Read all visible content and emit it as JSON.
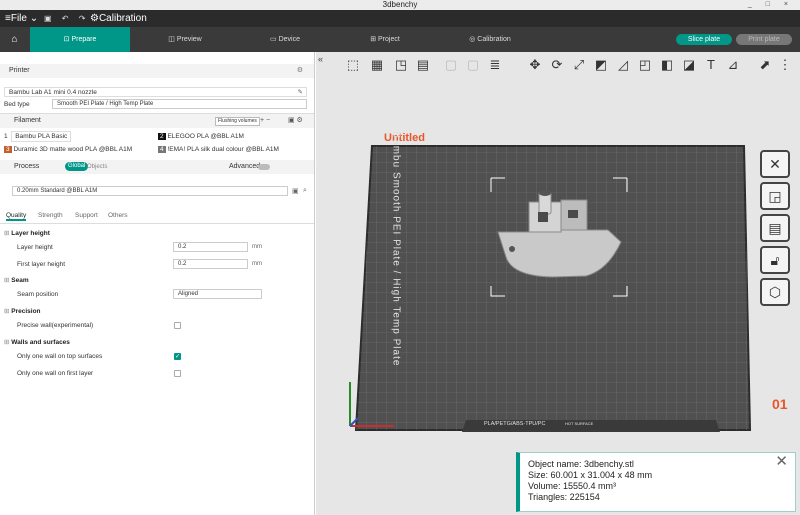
{
  "window": {
    "title": "3dbenchy",
    "controls": "_ □ ×"
  },
  "menubar": {
    "file": "≡File ⌄",
    "project_name": "⚙Calibration",
    "icons": "▣ ↶ ↷"
  },
  "tabs": [
    {
      "label": "Prepare",
      "icon": "⊡"
    },
    {
      "label": "Preview",
      "icon": "◫"
    },
    {
      "label": "Device",
      "icon": "▭"
    },
    {
      "label": "Project",
      "icon": "⊞"
    },
    {
      "label": "Calibration",
      "icon": "◎"
    }
  ],
  "actions": {
    "slice": "Slice plate",
    "print": "Print plate"
  },
  "printer": {
    "section": "Printer",
    "model": "Bambu Lab A1 mini 0.4 nozzle",
    "bed_type_label": "Bed type",
    "bed_type": "Smooth PEI Plate / High Temp Plate"
  },
  "filament": {
    "section": "Filament",
    "flushing": "Flushing volumes",
    "slots": [
      {
        "num": "1",
        "name": "Bambu PLA Basic",
        "color": "#f0f0f0"
      },
      {
        "num": "2",
        "name": "ELEGOO PLA @BBL A1M",
        "color": "#111111"
      },
      {
        "num": "3",
        "name": "Duramic 3D matte wood PLA @BBL A1M",
        "color": "#c06030"
      },
      {
        "num": "4",
        "name": "!EMA! PLA silk dual colour @BBL A1M",
        "color": "#777777"
      }
    ]
  },
  "process": {
    "section": "Process",
    "global": "Global",
    "objects": "Objects",
    "advanced": "Advanced",
    "preset": "0.20mm Standard @BBL A1M",
    "tabs": [
      "Quality",
      "Strength",
      "Support",
      "Others"
    ]
  },
  "settings": {
    "layer_height_group": "Layer height",
    "layer_height_label": "Layer height",
    "layer_height_value": "0.2",
    "first_layer_label": "First layer height",
    "first_layer_value": "0.2",
    "unit": "mm",
    "seam_group": "Seam",
    "seam_label": "Seam position",
    "seam_value": "Aligned",
    "precision_group": "Precision",
    "precise_wall_label": "Precise wall(experimental)",
    "walls_group": "Walls and surfaces",
    "top_wall_label": "Only one wall on top surfaces",
    "first_wall_label": "Only one wall on first layer"
  },
  "viewport": {
    "plate_name": "Untitled",
    "plate_text": "Bambu Smooth PEI Plate / High Temp Plate",
    "plate_label": "PLA/PETG/ABS·TPU/PC",
    "plate_label_small": "HOT SURFACE",
    "plate_number": "01"
  },
  "object_info": {
    "name": "Object name: 3dbenchy.stl",
    "size": "Size: 60.001 x 31.004 x 48 mm",
    "volume": "Volume: 15550.4 mm³",
    "triangles": "Triangles: 225154"
  }
}
